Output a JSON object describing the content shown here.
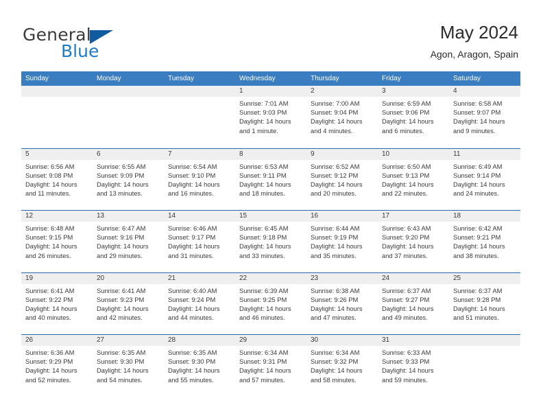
{
  "brand": {
    "name_part1": "General",
    "name_part2": "Blue",
    "triangle_icon": "triangle-icon"
  },
  "header": {
    "title": "May 2024",
    "subtitle": "Agon, Aragon, Spain"
  },
  "colors": {
    "header_blue": "#3a7dc0",
    "row_divider_blue": "#2c6aad",
    "daynum_band": "#efefef",
    "brand_blue": "#1f7ac4",
    "brand_triangle": "#125a9e",
    "text": "#3a3a3a"
  },
  "calendar": {
    "day_headers": [
      "Sunday",
      "Monday",
      "Tuesday",
      "Wednesday",
      "Thursday",
      "Friday",
      "Saturday"
    ],
    "weeks": [
      [
        {
          "day": "",
          "lines": []
        },
        {
          "day": "",
          "lines": []
        },
        {
          "day": "",
          "lines": []
        },
        {
          "day": "1",
          "lines": [
            "Sunrise: 7:01 AM",
            "Sunset: 9:03 PM",
            "Daylight: 14 hours",
            "and 1 minute."
          ]
        },
        {
          "day": "2",
          "lines": [
            "Sunrise: 7:00 AM",
            "Sunset: 9:04 PM",
            "Daylight: 14 hours",
            "and 4 minutes."
          ]
        },
        {
          "day": "3",
          "lines": [
            "Sunrise: 6:59 AM",
            "Sunset: 9:06 PM",
            "Daylight: 14 hours",
            "and 6 minutes."
          ]
        },
        {
          "day": "4",
          "lines": [
            "Sunrise: 6:58 AM",
            "Sunset: 9:07 PM",
            "Daylight: 14 hours",
            "and 9 minutes."
          ]
        }
      ],
      [
        {
          "day": "5",
          "lines": [
            "Sunrise: 6:56 AM",
            "Sunset: 9:08 PM",
            "Daylight: 14 hours",
            "and 11 minutes."
          ]
        },
        {
          "day": "6",
          "lines": [
            "Sunrise: 6:55 AM",
            "Sunset: 9:09 PM",
            "Daylight: 14 hours",
            "and 13 minutes."
          ]
        },
        {
          "day": "7",
          "lines": [
            "Sunrise: 6:54 AM",
            "Sunset: 9:10 PM",
            "Daylight: 14 hours",
            "and 16 minutes."
          ]
        },
        {
          "day": "8",
          "lines": [
            "Sunrise: 6:53 AM",
            "Sunset: 9:11 PM",
            "Daylight: 14 hours",
            "and 18 minutes."
          ]
        },
        {
          "day": "9",
          "lines": [
            "Sunrise: 6:52 AM",
            "Sunset: 9:12 PM",
            "Daylight: 14 hours",
            "and 20 minutes."
          ]
        },
        {
          "day": "10",
          "lines": [
            "Sunrise: 6:50 AM",
            "Sunset: 9:13 PM",
            "Daylight: 14 hours",
            "and 22 minutes."
          ]
        },
        {
          "day": "11",
          "lines": [
            "Sunrise: 6:49 AM",
            "Sunset: 9:14 PM",
            "Daylight: 14 hours",
            "and 24 minutes."
          ]
        }
      ],
      [
        {
          "day": "12",
          "lines": [
            "Sunrise: 6:48 AM",
            "Sunset: 9:15 PM",
            "Daylight: 14 hours",
            "and 26 minutes."
          ]
        },
        {
          "day": "13",
          "lines": [
            "Sunrise: 6:47 AM",
            "Sunset: 9:16 PM",
            "Daylight: 14 hours",
            "and 29 minutes."
          ]
        },
        {
          "day": "14",
          "lines": [
            "Sunrise: 6:46 AM",
            "Sunset: 9:17 PM",
            "Daylight: 14 hours",
            "and 31 minutes."
          ]
        },
        {
          "day": "15",
          "lines": [
            "Sunrise: 6:45 AM",
            "Sunset: 9:18 PM",
            "Daylight: 14 hours",
            "and 33 minutes."
          ]
        },
        {
          "day": "16",
          "lines": [
            "Sunrise: 6:44 AM",
            "Sunset: 9:19 PM",
            "Daylight: 14 hours",
            "and 35 minutes."
          ]
        },
        {
          "day": "17",
          "lines": [
            "Sunrise: 6:43 AM",
            "Sunset: 9:20 PM",
            "Daylight: 14 hours",
            "and 37 minutes."
          ]
        },
        {
          "day": "18",
          "lines": [
            "Sunrise: 6:42 AM",
            "Sunset: 9:21 PM",
            "Daylight: 14 hours",
            "and 38 minutes."
          ]
        }
      ],
      [
        {
          "day": "19",
          "lines": [
            "Sunrise: 6:41 AM",
            "Sunset: 9:22 PM",
            "Daylight: 14 hours",
            "and 40 minutes."
          ]
        },
        {
          "day": "20",
          "lines": [
            "Sunrise: 6:41 AM",
            "Sunset: 9:23 PM",
            "Daylight: 14 hours",
            "and 42 minutes."
          ]
        },
        {
          "day": "21",
          "lines": [
            "Sunrise: 6:40 AM",
            "Sunset: 9:24 PM",
            "Daylight: 14 hours",
            "and 44 minutes."
          ]
        },
        {
          "day": "22",
          "lines": [
            "Sunrise: 6:39 AM",
            "Sunset: 9:25 PM",
            "Daylight: 14 hours",
            "and 46 minutes."
          ]
        },
        {
          "day": "23",
          "lines": [
            "Sunrise: 6:38 AM",
            "Sunset: 9:26 PM",
            "Daylight: 14 hours",
            "and 47 minutes."
          ]
        },
        {
          "day": "24",
          "lines": [
            "Sunrise: 6:37 AM",
            "Sunset: 9:27 PM",
            "Daylight: 14 hours",
            "and 49 minutes."
          ]
        },
        {
          "day": "25",
          "lines": [
            "Sunrise: 6:37 AM",
            "Sunset: 9:28 PM",
            "Daylight: 14 hours",
            "and 51 minutes."
          ]
        }
      ],
      [
        {
          "day": "26",
          "lines": [
            "Sunrise: 6:36 AM",
            "Sunset: 9:29 PM",
            "Daylight: 14 hours",
            "and 52 minutes."
          ]
        },
        {
          "day": "27",
          "lines": [
            "Sunrise: 6:35 AM",
            "Sunset: 9:30 PM",
            "Daylight: 14 hours",
            "and 54 minutes."
          ]
        },
        {
          "day": "28",
          "lines": [
            "Sunrise: 6:35 AM",
            "Sunset: 9:30 PM",
            "Daylight: 14 hours",
            "and 55 minutes."
          ]
        },
        {
          "day": "29",
          "lines": [
            "Sunrise: 6:34 AM",
            "Sunset: 9:31 PM",
            "Daylight: 14 hours",
            "and 57 minutes."
          ]
        },
        {
          "day": "30",
          "lines": [
            "Sunrise: 6:34 AM",
            "Sunset: 9:32 PM",
            "Daylight: 14 hours",
            "and 58 minutes."
          ]
        },
        {
          "day": "31",
          "lines": [
            "Sunrise: 6:33 AM",
            "Sunset: 9:33 PM",
            "Daylight: 14 hours",
            "and 59 minutes."
          ]
        },
        {
          "day": "",
          "lines": []
        }
      ]
    ]
  }
}
